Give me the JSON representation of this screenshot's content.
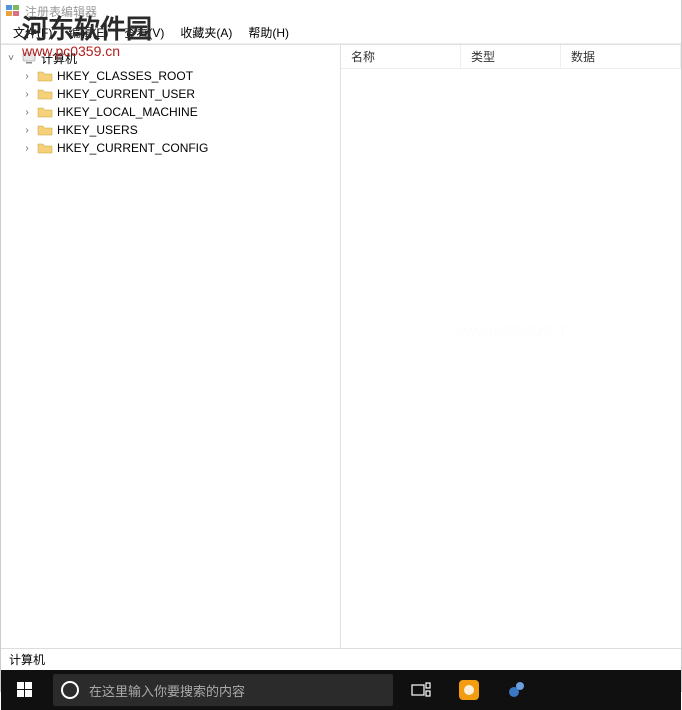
{
  "window": {
    "title": "注册表编辑器"
  },
  "menubar": {
    "file": "文件(F)",
    "edit": "编辑(E)",
    "view": "查看(V)",
    "favorites": "收藏夹(A)",
    "help": "帮助(H)"
  },
  "tree": {
    "root": "计算机",
    "hives": [
      "HKEY_CLASSES_ROOT",
      "HKEY_CURRENT_USER",
      "HKEY_LOCAL_MACHINE",
      "HKEY_USERS",
      "HKEY_CURRENT_CONFIG"
    ]
  },
  "list_headers": {
    "name": "名称",
    "type": "类型",
    "data": "数据"
  },
  "statusbar": {
    "path": "计算机"
  },
  "taskbar": {
    "search_placeholder": "在这里输入你要搜索的内容"
  },
  "watermarks": {
    "main": "河东软件园",
    "url": "www.pc0359.cn",
    "center": "www.pc0359.NET"
  }
}
